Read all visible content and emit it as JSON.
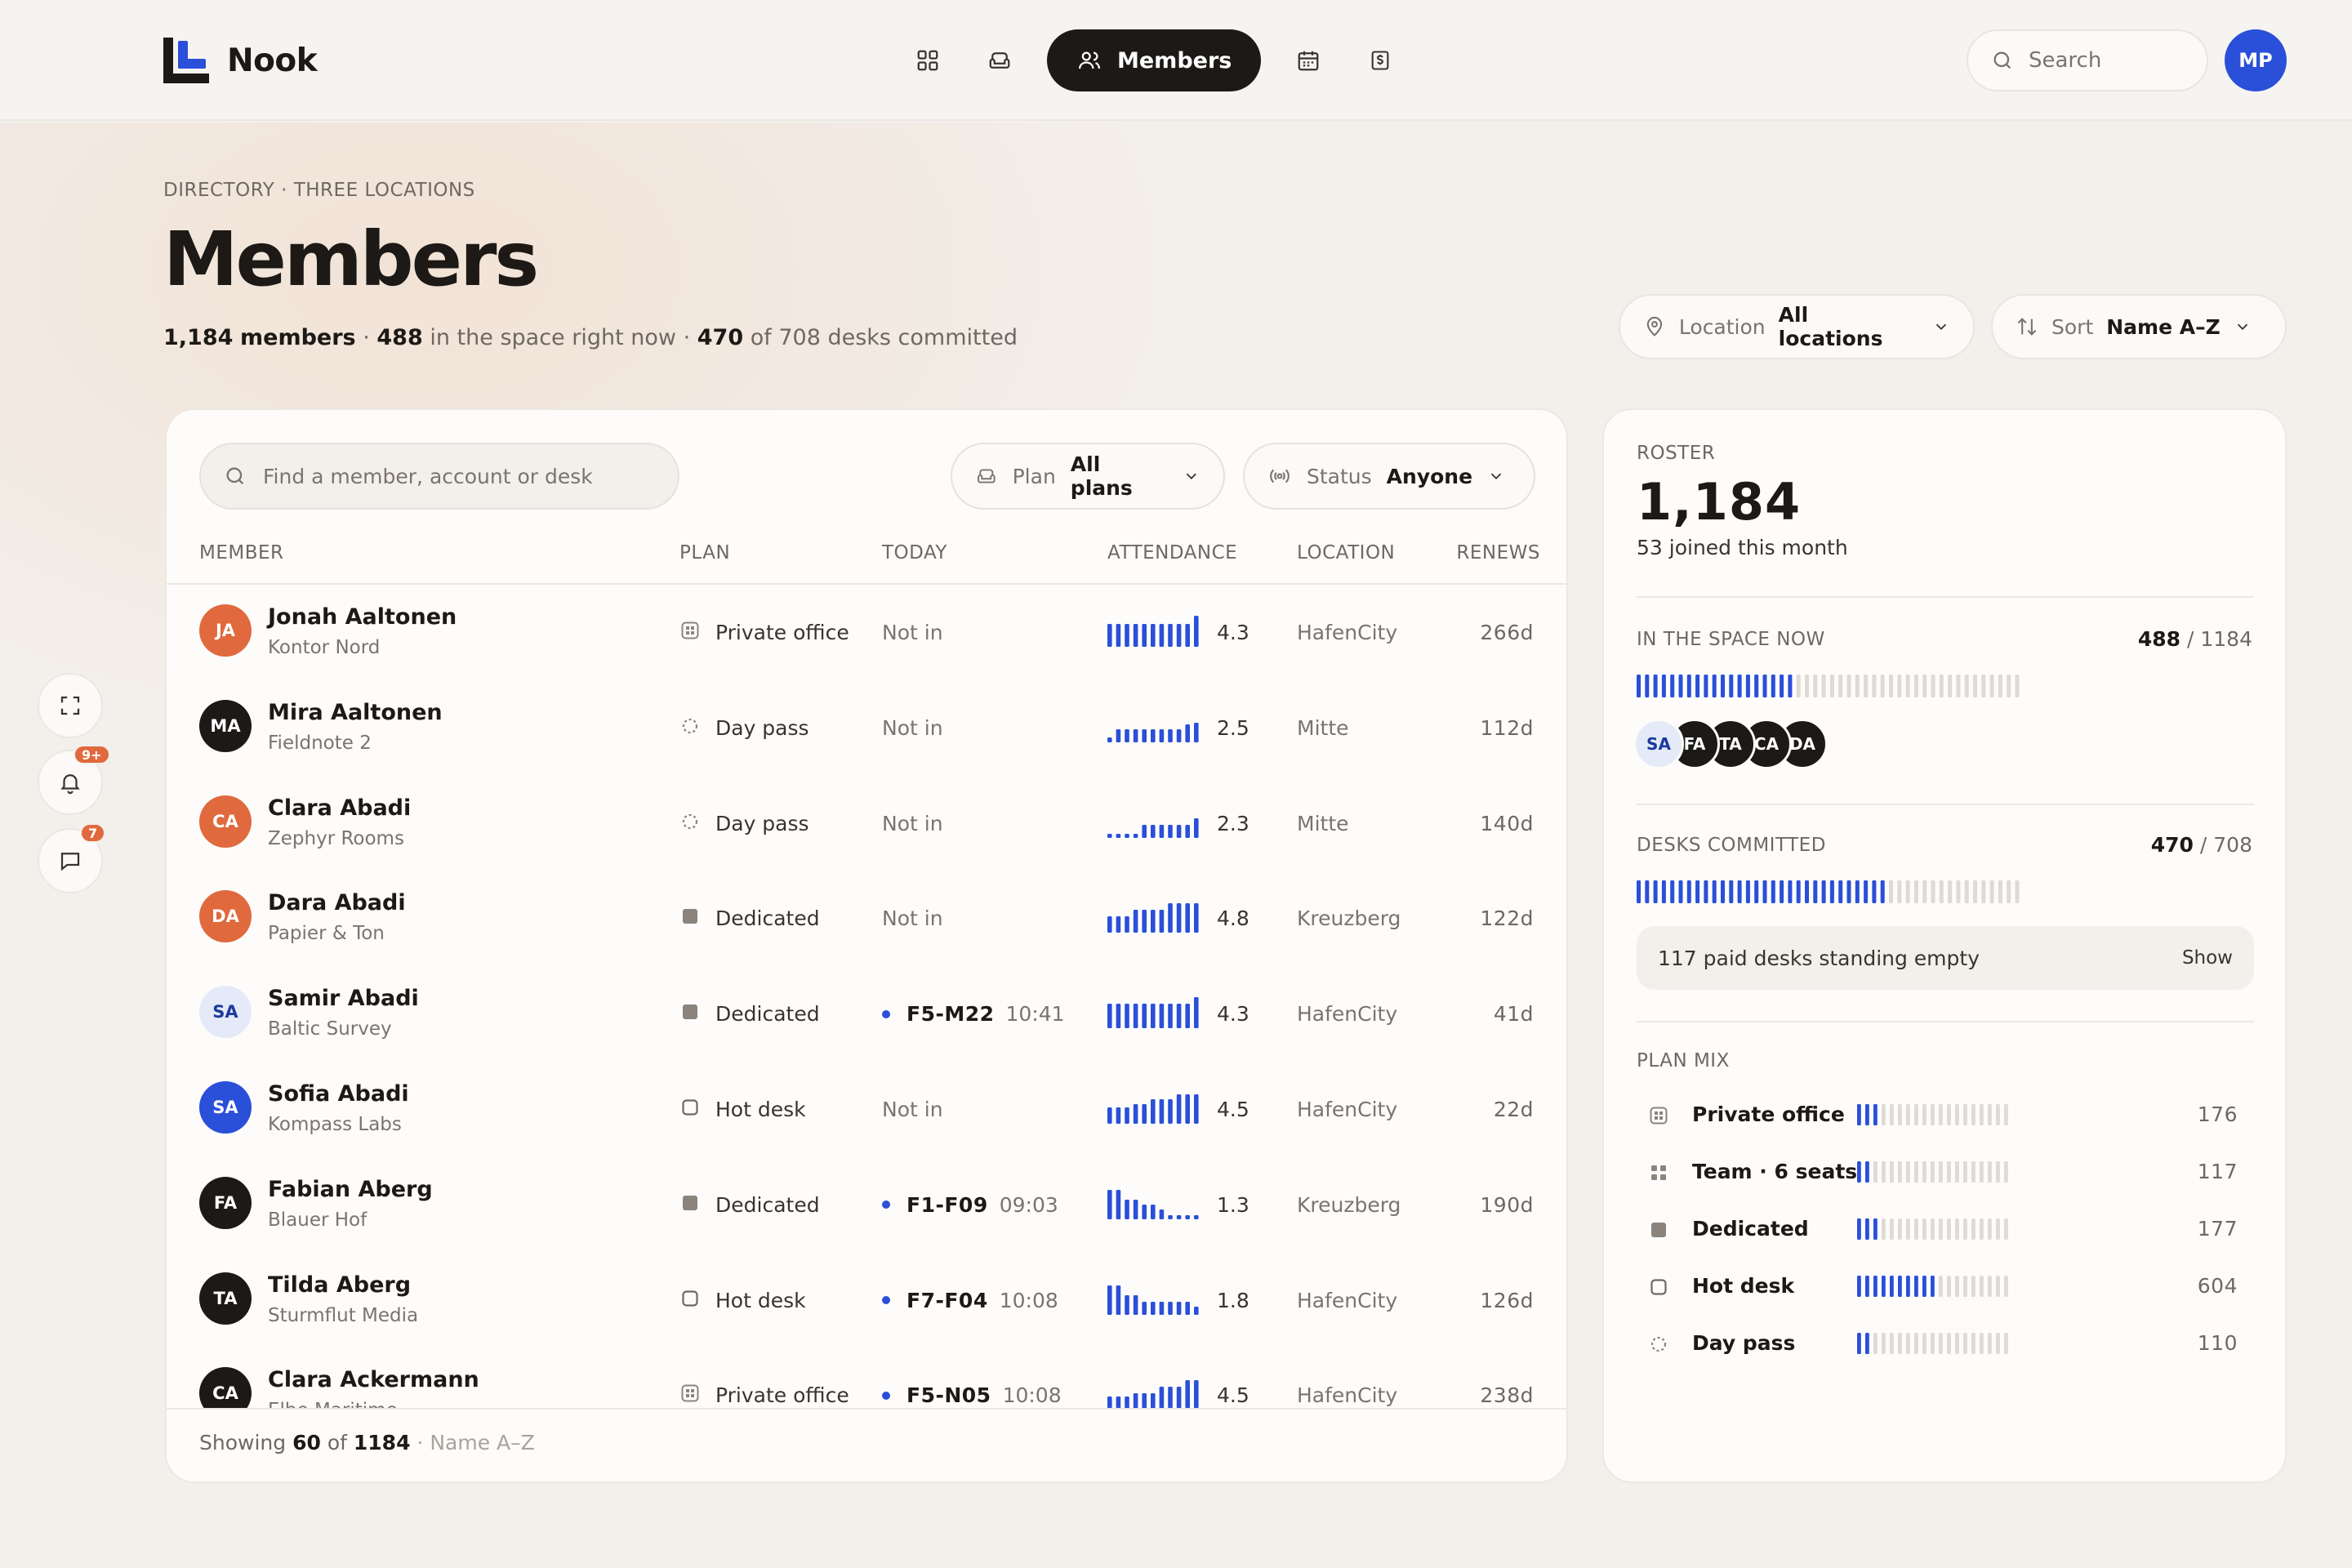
{
  "app": {
    "name": "Nook"
  },
  "nav": {
    "items": [
      "dashboard-icon",
      "spaces-icon",
      "members",
      "calendar-icon",
      "billing-icon"
    ],
    "active_label": "Members"
  },
  "search": {
    "placeholder": "Search"
  },
  "user": {
    "initials": "MP"
  },
  "colors": {
    "accent": "#2a4fd8",
    "orange": "#e0693e",
    "dark": "#1c1916"
  },
  "page": {
    "breadcrumb": "DIRECTORY · THREE LOCATIONS",
    "title": "Members",
    "stats": {
      "members": "1,184",
      "members_label": "members",
      "sep1": "·",
      "in_space": "488",
      "in_space_label": "in the space right now",
      "sep2": "·",
      "committed": "470",
      "committed_label": "of 708 desks committed"
    }
  },
  "filters": {
    "location": {
      "label": "Location",
      "value": "All locations"
    },
    "sort": {
      "label": "Sort",
      "value": "Name A–Z"
    }
  },
  "table": {
    "find_placeholder": "Find a member, account or desk",
    "plan_filter": {
      "label": "Plan",
      "value": "All plans"
    },
    "status_filter": {
      "label": "Status",
      "value": "Anyone"
    },
    "columns": {
      "member": "MEMBER",
      "plan": "PLAN",
      "today": "TODAY",
      "attendance": "ATTENDANCE",
      "location": "LOCATION",
      "renews": "RENEWS"
    },
    "rows": [
      {
        "initials": "JA",
        "avatar": "orange",
        "name": "Jonah Aaltonen",
        "company": "Kontor Nord",
        "plan": "Private office",
        "plan_icon": "private-office-icon",
        "today": "Not in",
        "desk": "",
        "time": "",
        "attendance": [
          0.7,
          0.7,
          0.7,
          0.7,
          0.7,
          0.7,
          0.7,
          0.7,
          0.7,
          0.7,
          0.95
        ],
        "score": "4.3",
        "location": "HafenCity",
        "renews": "266d"
      },
      {
        "initials": "MA",
        "avatar": "dark",
        "name": "Mira Aaltonen",
        "company": "Fieldnote 2",
        "plan": "Day pass",
        "plan_icon": "day-pass-icon",
        "today": "Not in",
        "desk": "",
        "time": "",
        "attendance": [
          0.15,
          0.4,
          0.4,
          0.4,
          0.4,
          0.4,
          0.4,
          0.4,
          0.4,
          0.55,
          0.6
        ],
        "score": "2.5",
        "location": "Mitte",
        "renews": "112d"
      },
      {
        "initials": "CA",
        "avatar": "orange",
        "name": "Clara Abadi",
        "company": "Zephyr Rooms",
        "plan": "Day pass",
        "plan_icon": "day-pass-icon",
        "today": "Not in",
        "desk": "",
        "time": "",
        "attendance": [
          0.1,
          0.1,
          0.1,
          0.1,
          0.4,
          0.4,
          0.4,
          0.4,
          0.4,
          0.4,
          0.6
        ],
        "score": "2.3",
        "location": "Mitte",
        "renews": "140d"
      },
      {
        "initials": "DA",
        "avatar": "orange",
        "name": "Dara Abadi",
        "company": "Papier & Ton",
        "plan": "Dedicated",
        "plan_icon": "dedicated-icon",
        "today": "Not in",
        "desk": "",
        "time": "",
        "attendance": [
          0.5,
          0.5,
          0.5,
          0.7,
          0.7,
          0.7,
          0.7,
          0.9,
          0.9,
          0.9,
          0.9
        ],
        "score": "4.8",
        "location": "Kreuzberg",
        "renews": "122d"
      },
      {
        "initials": "SA",
        "avatar": "light",
        "name": "Samir Abadi",
        "company": "Baltic Survey",
        "plan": "Dedicated",
        "plan_icon": "dedicated-icon",
        "today": "",
        "desk": "F5-M22",
        "time": "10:41",
        "attendance": [
          0.75,
          0.75,
          0.75,
          0.75,
          0.75,
          0.75,
          0.75,
          0.75,
          0.75,
          0.75,
          0.95
        ],
        "score": "4.3",
        "location": "HafenCity",
        "renews": "41d"
      },
      {
        "initials": "SA",
        "avatar": "blue",
        "name": "Sofia Abadi",
        "company": "Kompass Labs",
        "plan": "Hot desk",
        "plan_icon": "hot-desk-icon",
        "today": "Not in",
        "desk": "",
        "time": "",
        "attendance": [
          0.5,
          0.5,
          0.5,
          0.6,
          0.6,
          0.75,
          0.75,
          0.75,
          0.9,
          0.9,
          0.9
        ],
        "score": "4.5",
        "location": "HafenCity",
        "renews": "22d"
      },
      {
        "initials": "FA",
        "avatar": "dark",
        "name": "Fabian Aberg",
        "company": "Blauer Hof",
        "plan": "Dedicated",
        "plan_icon": "dedicated-icon",
        "today": "",
        "desk": "F1-F09",
        "time": "09:03",
        "attendance": [
          0.9,
          0.9,
          0.6,
          0.6,
          0.45,
          0.45,
          0.3,
          0.12,
          0.12,
          0.12,
          0.12
        ],
        "score": "1.3",
        "location": "Kreuzberg",
        "renews": "190d"
      },
      {
        "initials": "TA",
        "avatar": "dark",
        "name": "Tilda Aberg",
        "company": "Sturmflut Media",
        "plan": "Hot desk",
        "plan_icon": "hot-desk-icon",
        "today": "",
        "desk": "F7-F04",
        "time": "10:08",
        "attendance": [
          0.9,
          0.9,
          0.6,
          0.6,
          0.4,
          0.4,
          0.4,
          0.4,
          0.4,
          0.4,
          0.25
        ],
        "score": "1.8",
        "location": "HafenCity",
        "renews": "126d"
      },
      {
        "initials": "CA",
        "avatar": "dark",
        "name": "Clara Ackermann",
        "company": "Elbe Maritime",
        "plan": "Private office",
        "plan_icon": "private-office-icon",
        "today": "",
        "desk": "F5-N05",
        "time": "10:08",
        "attendance": [
          0.4,
          0.4,
          0.4,
          0.5,
          0.5,
          0.5,
          0.7,
          0.7,
          0.7,
          0.9,
          0.9
        ],
        "score": "4.5",
        "location": "HafenCity",
        "renews": "238d"
      }
    ],
    "footer": {
      "prefix": "Showing",
      "shown": "60",
      "of": "of",
      "total": "1184",
      "sort_note": "· Name A–Z"
    }
  },
  "roster": {
    "label": "ROSTER",
    "total": "1,184",
    "joined": "53 joined this month",
    "in_space": {
      "label": "IN THE SPACE NOW",
      "value": "488",
      "sep": "/",
      "total": "1184",
      "ratio": 0.41,
      "avatars": [
        {
          "initials": "SA",
          "style": "light"
        },
        {
          "initials": "FA",
          "style": "dark"
        },
        {
          "initials": "TA",
          "style": "dark"
        },
        {
          "initials": "CA",
          "style": "dark"
        },
        {
          "initials": "DA",
          "style": "dark"
        }
      ]
    },
    "desks": {
      "label": "DESKS COMMITTED",
      "value": "470",
      "sep": "/",
      "total": "708",
      "ratio": 0.66,
      "empty_note": "117 paid desks standing empty",
      "show_label": "Show"
    },
    "plan_mix": {
      "label": "PLAN MIX",
      "items": [
        {
          "label": "Private office",
          "icon": "private-office-icon",
          "count": "176",
          "ratio": 0.15
        },
        {
          "label": "Team · 6 seats",
          "icon": "team-icon",
          "count": "117",
          "ratio": 0.1
        },
        {
          "label": "Dedicated",
          "icon": "dedicated-icon",
          "count": "177",
          "ratio": 0.15
        },
        {
          "label": "Hot desk",
          "icon": "hot-desk-icon",
          "count": "604",
          "ratio": 0.51
        },
        {
          "label": "Day pass",
          "icon": "day-pass-icon",
          "count": "110",
          "ratio": 0.09
        }
      ]
    }
  },
  "rail": {
    "notif_badge": "9+",
    "chat_badge": "7"
  }
}
